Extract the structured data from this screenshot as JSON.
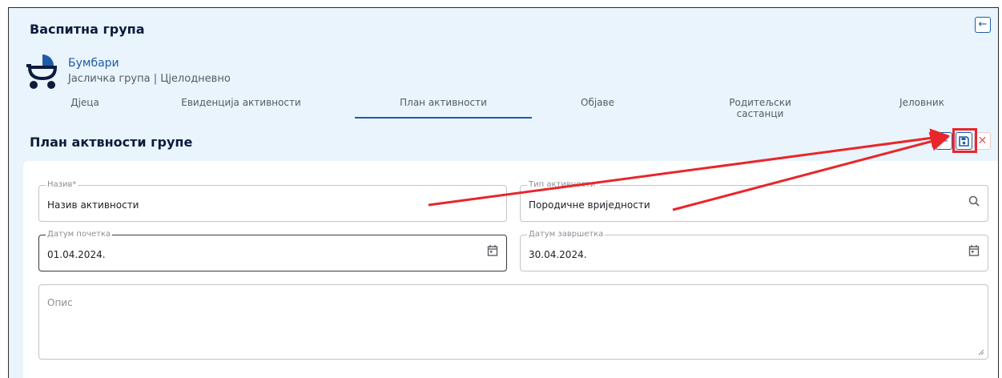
{
  "header": {
    "title": "Васпитна група",
    "back_icon": "arrow-left-icon"
  },
  "group": {
    "icon": "baby-stroller-icon",
    "name": "Бумбари",
    "subtitle": "Јасличка група | Цјелодневно"
  },
  "tabs": [
    {
      "label": "Дјеца"
    },
    {
      "label": "Евиденција активности"
    },
    {
      "label": "План активности",
      "active": true
    },
    {
      "label": "Објаве"
    },
    {
      "label": "Родитељски састанци"
    },
    {
      "label": "Јеловник"
    }
  ],
  "section": {
    "title": "План актвности групе",
    "actions": {
      "back_icon": "arrow-left-icon",
      "save_icon": "floppy-disk-icon",
      "cancel_icon": "close-icon"
    }
  },
  "form": {
    "name": {
      "label": "Назив*",
      "value": "Назив активности"
    },
    "type": {
      "label": "Тип активности*",
      "value": "Породичне вриједности",
      "icon": "search-icon"
    },
    "start": {
      "label": "Датум почетка",
      "value": "01.04.2024.",
      "icon": "calendar-icon"
    },
    "end": {
      "label": "Датум завршетка",
      "value": "30.04.2024.",
      "icon": "calendar-icon"
    },
    "description": {
      "placeholder": "Опис",
      "value": ""
    }
  },
  "colors": {
    "accent": "#1e5ba8",
    "background": "#e9f4fc",
    "annotation": "#e8262b",
    "title": "#0d1b3d"
  }
}
